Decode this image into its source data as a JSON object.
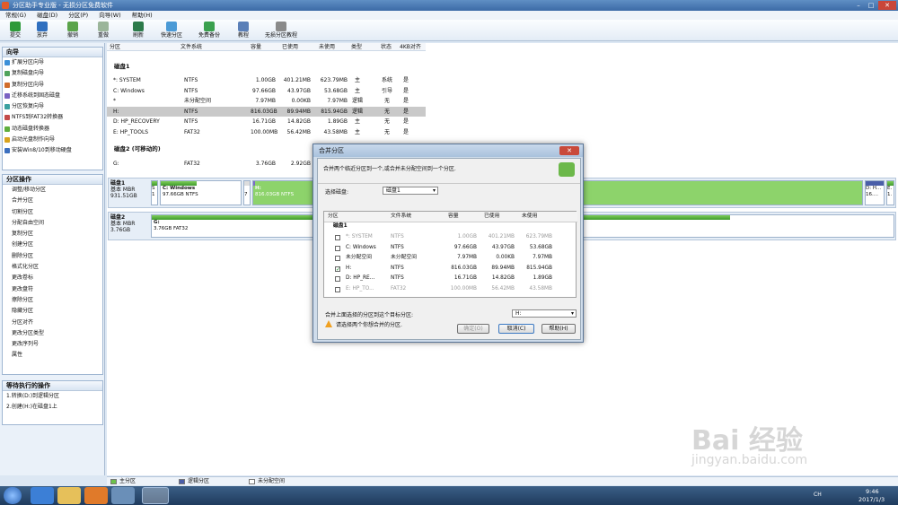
{
  "window": {
    "title": "分区助手专业版 - 无损分区免费软件",
    "min": "–",
    "max": "□",
    "close": "✕"
  },
  "menu": [
    "常规(G)",
    "磁盘(D)",
    "分区(P)",
    "向导(W)",
    "帮助(H)"
  ],
  "toolbar": [
    {
      "label": "提交",
      "icon": "check-icon"
    },
    {
      "label": "放弃",
      "icon": "discard-icon"
    },
    {
      "label": "撤销",
      "icon": "undo-icon"
    },
    {
      "label": "重做",
      "icon": "redo-icon"
    },
    {
      "label": "刷新",
      "icon": "refresh-icon"
    },
    {
      "label": "快速分区",
      "icon": "quick-partition-icon"
    },
    {
      "label": "免费备份",
      "icon": "backup-icon"
    },
    {
      "label": "教程",
      "icon": "tutorial-icon"
    },
    {
      "label": "无损分区教程",
      "icon": "lossless-tutorial-icon"
    }
  ],
  "wizard": {
    "title": "向导",
    "items": [
      "扩展分区向导",
      "复制磁盘向导",
      "复制分区向导",
      "迁移系统到固态磁盘",
      "分区恢复向导",
      "NTFS到FAT32转换器",
      "动态磁盘转换器",
      "启动光盘制作向导",
      "安装Win8/10到移动硬盘"
    ]
  },
  "partops": {
    "title": "分区操作",
    "items": [
      "调整/移动分区",
      "合并分区",
      "切割分区",
      "分配自由空间",
      "复制分区",
      "创建分区",
      "删除分区",
      "格式化分区",
      "更改卷标",
      "更改盘符",
      "擦除分区",
      "隐藏分区",
      "分区对齐",
      "更改分区类型",
      "更改序列号",
      "属性"
    ]
  },
  "pending": {
    "title": "等待执行的操作",
    "items": [
      "1.转换(D:)到逻辑分区",
      "2.创建(H:)在磁盘1上"
    ]
  },
  "table": {
    "headers": [
      "分区",
      "文件系统",
      "容量",
      "已使用",
      "未使用",
      "类型",
      "状态",
      "4KB对齐"
    ],
    "disk1_label": "磁盘1",
    "disk1_rows": [
      [
        "*: SYSTEM",
        "NTFS",
        "1.00GB",
        "401.21MB",
        "623.79MB",
        "主",
        "系统",
        "是"
      ],
      [
        "C: Windows",
        "NTFS",
        "97.66GB",
        "43.97GB",
        "53.68GB",
        "主",
        "引导",
        "是"
      ],
      [
        "*",
        "未分配空间",
        "7.97MB",
        "0.00KB",
        "7.97MB",
        "逻辑",
        "无",
        "是"
      ],
      [
        "H:",
        "NTFS",
        "816.03GB",
        "89.94MB",
        "815.94GB",
        "逻辑",
        "无",
        "是"
      ],
      [
        "D: HP_RECOVERY",
        "NTFS",
        "16.71GB",
        "14.82GB",
        "1.89GB",
        "主",
        "无",
        "是"
      ],
      [
        "E: HP_TOOLS",
        "FAT32",
        "100.00MB",
        "56.42MB",
        "43.58MB",
        "主",
        "无",
        "是"
      ]
    ],
    "disk2_label": "磁盘2 (可移动的)",
    "disk2_rows": [
      [
        "G:",
        "FAT32",
        "3.76GB",
        "2.92GB",
        "",
        "",
        "",
        ""
      ]
    ]
  },
  "diskmap": {
    "disk1": {
      "name": "磁盘1",
      "type": "基本 MBR",
      "size": "931.51GB",
      "parts": [
        {
          "l1": "S",
          "l2": "1"
        },
        {
          "l1": "C: Windows",
          "l2": "97.66GB NTFS"
        },
        {
          "l1": "",
          "l2": "7"
        },
        {
          "l1": "H:",
          "l2": "816.03GB NTFS"
        },
        {
          "l1": "D: H...",
          "l2": "16...."
        },
        {
          "l1": "E.",
          "l2": "1."
        }
      ]
    },
    "disk2": {
      "name": "磁盘2",
      "type": "基本 MBR",
      "size": "3.76GB",
      "parts": [
        {
          "l1": "G:",
          "l2": "3.76GB FAT32"
        }
      ]
    }
  },
  "legend": [
    "主分区",
    "逻辑分区",
    "未分配空间"
  ],
  "dialog": {
    "title": "合并分区",
    "desc": "合并两个临近分区到一个,或合并未分配空间到一个分区.",
    "select_label": "选择磁盘:",
    "select_value": "磁盘1",
    "headers": [
      "分区",
      "文件系统",
      "容量",
      "已使用",
      "未使用"
    ],
    "group": "磁盘1",
    "rows": [
      {
        "check": "",
        "name": "*: SYSTEM",
        "fs": "NTFS",
        "cap": "1.00GB",
        "used": "401.21MB",
        "free": "623.79MB",
        "disabled": true
      },
      {
        "check": "",
        "name": "C: Windows",
        "fs": "NTFS",
        "cap": "97.66GB",
        "used": "43.97GB",
        "free": "53.68GB",
        "disabled": false
      },
      {
        "check": "",
        "name": "未分配空间",
        "fs": "未分配空间",
        "cap": "7.97MB",
        "used": "0.00KB",
        "free": "7.97MB",
        "disabled": false
      },
      {
        "check": "✓",
        "name": "H:",
        "fs": "NTFS",
        "cap": "816.03GB",
        "used": "89.94MB",
        "free": "815.94GB",
        "disabled": false
      },
      {
        "check": "",
        "name": "D: HP_RE...",
        "fs": "NTFS",
        "cap": "16.71GB",
        "used": "14.82GB",
        "free": "1.89GB",
        "disabled": false
      },
      {
        "check": "",
        "name": "E: HP_TO...",
        "fs": "FAT32",
        "cap": "100.00MB",
        "used": "56.42MB",
        "free": "43.58MB",
        "disabled": true
      }
    ],
    "target_label": "合并上面选择的分区到这个目标分区:",
    "target_value": "H:",
    "warning": "请选择两个你想合并的分区.",
    "ok": "确定(O)",
    "cancel": "取消(C)",
    "help": "帮助(H)"
  },
  "tray": {
    "lang": "CH",
    "time": "9:46",
    "date": "2017/1/3"
  },
  "watermark": {
    "text": "Bai 经验",
    "url": "jingyan.baidu.com"
  }
}
